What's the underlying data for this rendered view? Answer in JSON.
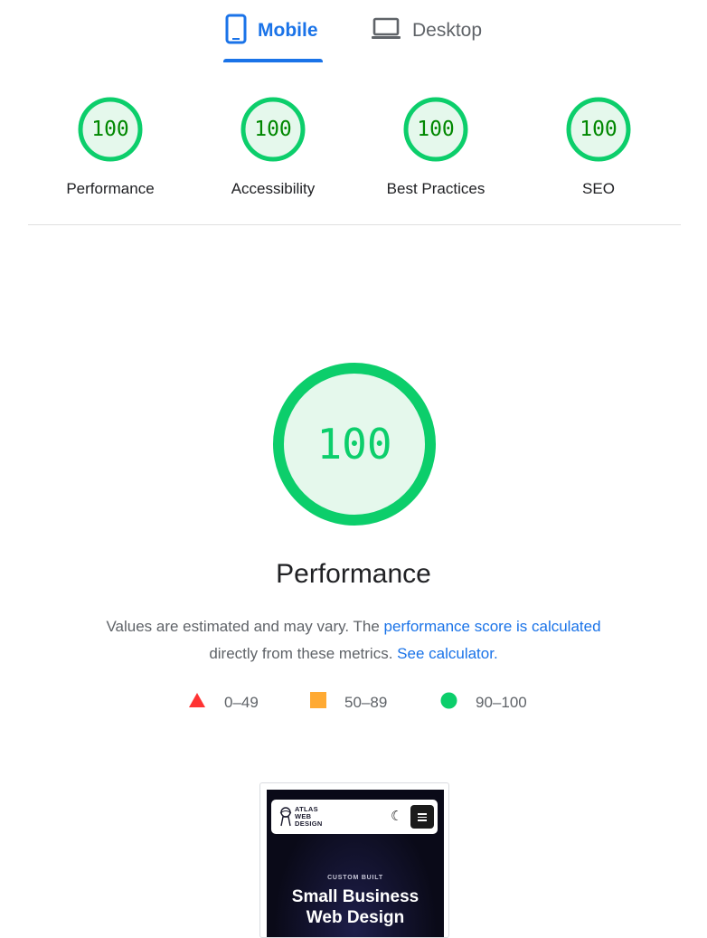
{
  "tabs": [
    {
      "label": "Mobile",
      "icon": "smartphone-icon",
      "active": true
    },
    {
      "label": "Desktop",
      "icon": "laptop-icon",
      "active": false
    }
  ],
  "categories": [
    {
      "score": "100",
      "label": "Performance"
    },
    {
      "score": "100",
      "label": "Accessibility"
    },
    {
      "score": "100",
      "label": "Best Practices"
    },
    {
      "score": "100",
      "label": "SEO"
    }
  ],
  "main": {
    "score": "100",
    "title": "Performance",
    "description_prefix": "Values are estimated and may vary. The ",
    "description_link": "performance score is calculated",
    "description_middle": " directly from these metrics.",
    "calculator_link": "See calculator."
  },
  "legend": [
    {
      "range": "0–49",
      "shape": "triangle",
      "color": "#ff3333"
    },
    {
      "range": "50–89",
      "shape": "square",
      "color": "#ffaa33"
    },
    {
      "range": "90–100",
      "shape": "circle",
      "color": "#0cce6b"
    }
  ],
  "screenshot": {
    "logo_lines": [
      "ATLAS",
      "WEB",
      "DESIGN"
    ],
    "eyebrow": "CUSTOM BUILT",
    "hero_line1": "Small Business",
    "hero_line2": "Web Design"
  },
  "colors": {
    "accent": "#1a73e8",
    "pass": "#0cce6b",
    "pass_fill": "#e5f8ec",
    "pass_text": "#008800"
  }
}
